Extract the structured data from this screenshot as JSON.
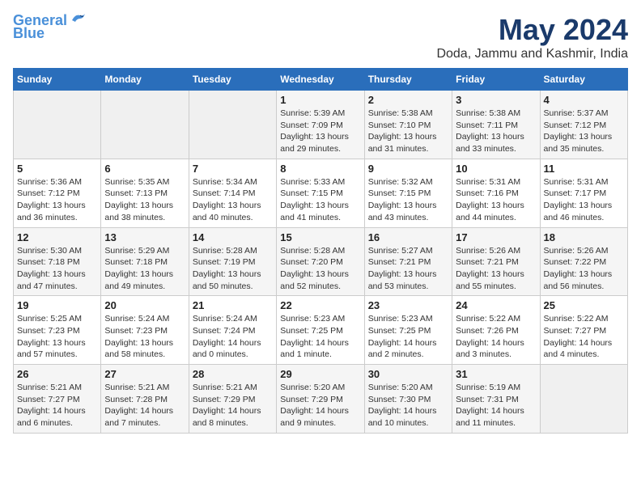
{
  "logo": {
    "line1": "General",
    "line2": "Blue"
  },
  "title": "May 2024",
  "subtitle": "Doda, Jammu and Kashmir, India",
  "days_of_week": [
    "Sunday",
    "Monday",
    "Tuesday",
    "Wednesday",
    "Thursday",
    "Friday",
    "Saturday"
  ],
  "weeks": [
    [
      {
        "day": "",
        "info": ""
      },
      {
        "day": "",
        "info": ""
      },
      {
        "day": "",
        "info": ""
      },
      {
        "day": "1",
        "info": "Sunrise: 5:39 AM\nSunset: 7:09 PM\nDaylight: 13 hours\nand 29 minutes."
      },
      {
        "day": "2",
        "info": "Sunrise: 5:38 AM\nSunset: 7:10 PM\nDaylight: 13 hours\nand 31 minutes."
      },
      {
        "day": "3",
        "info": "Sunrise: 5:38 AM\nSunset: 7:11 PM\nDaylight: 13 hours\nand 33 minutes."
      },
      {
        "day": "4",
        "info": "Sunrise: 5:37 AM\nSunset: 7:12 PM\nDaylight: 13 hours\nand 35 minutes."
      }
    ],
    [
      {
        "day": "5",
        "info": "Sunrise: 5:36 AM\nSunset: 7:12 PM\nDaylight: 13 hours\nand 36 minutes."
      },
      {
        "day": "6",
        "info": "Sunrise: 5:35 AM\nSunset: 7:13 PM\nDaylight: 13 hours\nand 38 minutes."
      },
      {
        "day": "7",
        "info": "Sunrise: 5:34 AM\nSunset: 7:14 PM\nDaylight: 13 hours\nand 40 minutes."
      },
      {
        "day": "8",
        "info": "Sunrise: 5:33 AM\nSunset: 7:15 PM\nDaylight: 13 hours\nand 41 minutes."
      },
      {
        "day": "9",
        "info": "Sunrise: 5:32 AM\nSunset: 7:15 PM\nDaylight: 13 hours\nand 43 minutes."
      },
      {
        "day": "10",
        "info": "Sunrise: 5:31 AM\nSunset: 7:16 PM\nDaylight: 13 hours\nand 44 minutes."
      },
      {
        "day": "11",
        "info": "Sunrise: 5:31 AM\nSunset: 7:17 PM\nDaylight: 13 hours\nand 46 minutes."
      }
    ],
    [
      {
        "day": "12",
        "info": "Sunrise: 5:30 AM\nSunset: 7:18 PM\nDaylight: 13 hours\nand 47 minutes."
      },
      {
        "day": "13",
        "info": "Sunrise: 5:29 AM\nSunset: 7:18 PM\nDaylight: 13 hours\nand 49 minutes."
      },
      {
        "day": "14",
        "info": "Sunrise: 5:28 AM\nSunset: 7:19 PM\nDaylight: 13 hours\nand 50 minutes."
      },
      {
        "day": "15",
        "info": "Sunrise: 5:28 AM\nSunset: 7:20 PM\nDaylight: 13 hours\nand 52 minutes."
      },
      {
        "day": "16",
        "info": "Sunrise: 5:27 AM\nSunset: 7:21 PM\nDaylight: 13 hours\nand 53 minutes."
      },
      {
        "day": "17",
        "info": "Sunrise: 5:26 AM\nSunset: 7:21 PM\nDaylight: 13 hours\nand 55 minutes."
      },
      {
        "day": "18",
        "info": "Sunrise: 5:26 AM\nSunset: 7:22 PM\nDaylight: 13 hours\nand 56 minutes."
      }
    ],
    [
      {
        "day": "19",
        "info": "Sunrise: 5:25 AM\nSunset: 7:23 PM\nDaylight: 13 hours\nand 57 minutes."
      },
      {
        "day": "20",
        "info": "Sunrise: 5:24 AM\nSunset: 7:23 PM\nDaylight: 13 hours\nand 58 minutes."
      },
      {
        "day": "21",
        "info": "Sunrise: 5:24 AM\nSunset: 7:24 PM\nDaylight: 14 hours\nand 0 minutes."
      },
      {
        "day": "22",
        "info": "Sunrise: 5:23 AM\nSunset: 7:25 PM\nDaylight: 14 hours\nand 1 minute."
      },
      {
        "day": "23",
        "info": "Sunrise: 5:23 AM\nSunset: 7:25 PM\nDaylight: 14 hours\nand 2 minutes."
      },
      {
        "day": "24",
        "info": "Sunrise: 5:22 AM\nSunset: 7:26 PM\nDaylight: 14 hours\nand 3 minutes."
      },
      {
        "day": "25",
        "info": "Sunrise: 5:22 AM\nSunset: 7:27 PM\nDaylight: 14 hours\nand 4 minutes."
      }
    ],
    [
      {
        "day": "26",
        "info": "Sunrise: 5:21 AM\nSunset: 7:27 PM\nDaylight: 14 hours\nand 6 minutes."
      },
      {
        "day": "27",
        "info": "Sunrise: 5:21 AM\nSunset: 7:28 PM\nDaylight: 14 hours\nand 7 minutes."
      },
      {
        "day": "28",
        "info": "Sunrise: 5:21 AM\nSunset: 7:29 PM\nDaylight: 14 hours\nand 8 minutes."
      },
      {
        "day": "29",
        "info": "Sunrise: 5:20 AM\nSunset: 7:29 PM\nDaylight: 14 hours\nand 9 minutes."
      },
      {
        "day": "30",
        "info": "Sunrise: 5:20 AM\nSunset: 7:30 PM\nDaylight: 14 hours\nand 10 minutes."
      },
      {
        "day": "31",
        "info": "Sunrise: 5:19 AM\nSunset: 7:31 PM\nDaylight: 14 hours\nand 11 minutes."
      },
      {
        "day": "",
        "info": ""
      }
    ]
  ]
}
